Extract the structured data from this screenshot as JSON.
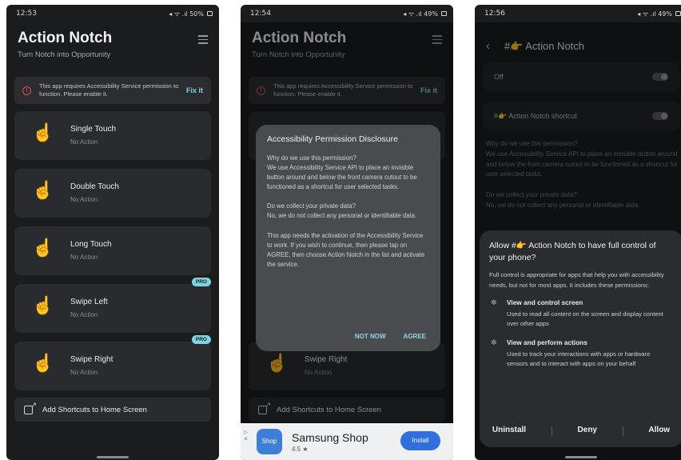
{
  "screen1": {
    "status": {
      "time": "12:53",
      "icons": "◂ ᯤ .ıl 50%"
    },
    "title": "Action Notch",
    "subtitle": "Turn Notch into Opportunity",
    "banner": {
      "text": "This app requires Accessibility Service permission to function. Please enable it.",
      "action": "Fix it"
    },
    "cards": [
      {
        "title": "Single Touch",
        "sub": "No Action",
        "pro": ""
      },
      {
        "title": "Double Touch",
        "sub": "No Action",
        "pro": ""
      },
      {
        "title": "Long Touch",
        "sub": "No Action",
        "pro": ""
      },
      {
        "title": "Swipe Left",
        "sub": "No Action",
        "pro": "PRO"
      },
      {
        "title": "Swipe Right",
        "sub": "No Action",
        "pro": "PRO"
      }
    ],
    "shortcut": "Add Shortcuts to Home Screen"
  },
  "screen2": {
    "status": {
      "time": "12:54",
      "icons": "◂ ᯤ .ıl 49%"
    },
    "title": "Action Notch",
    "subtitle": "Turn Notch into Opportunity",
    "banner": {
      "text": "This app requires Accessibility Service permission to function. Please enable it.",
      "action": "Fix it"
    },
    "bg_card": {
      "title": "Swipe Right",
      "sub": "No Action"
    },
    "shortcut": "Add Shortcuts to Home Screen",
    "dialog": {
      "title": "Accessibility Permission Disclosure",
      "body": "Why do we use this permission?\nWe use Accessibility Service API to place an invisible button around and below the front camera cutout to be functioned as a shortcut for user selected tasks.\n\nDo we collect your private data?\nNo, we do not collect any personal or identifiable data.\n\nThis app needs the activation of the Accessibility Service to work. If you wish to continue, then please tap on AGREE, then choose Action Notch in the list and activate the service.",
      "not_now": "NOT NOW",
      "agree": "AGREE"
    },
    "ad": {
      "logo": "Shop",
      "name": "Samsung Shop",
      "rating": "4.5 ★",
      "button": "Install"
    }
  },
  "screen3": {
    "status": {
      "time": "12:56",
      "icons": "◂ ᯤ .ıl 49%"
    },
    "title": "#👉 Action Notch",
    "row_off": "Off",
    "row_shortcut": "#👉 Action Notch shortcut",
    "faded_text": "Why do we use this permission?\nWe use Accessibility Service API to place an invisible button around and below the front camera cutout to be functioned as a shortcut for user selected tasks.\n\nDo we collect your private data?\nNo, we do not collect any personal or identifiable data.",
    "sheet": {
      "title": "Allow #👉 Action Notch to have full control of your phone?",
      "desc": "Full control is appropriate for apps that help you with accessibility needs, but not for most apps. It includes these permissions:",
      "perms": [
        {
          "title": "View and control screen",
          "desc": "Used to read all content on the screen and display content over other apps"
        },
        {
          "title": "View and perform actions",
          "desc": "Used to track your interactions with apps or hardware sensors and to interact with apps on your behalf"
        }
      ],
      "uninstall": "Uninstall",
      "deny": "Deny",
      "allow": "Allow"
    }
  }
}
